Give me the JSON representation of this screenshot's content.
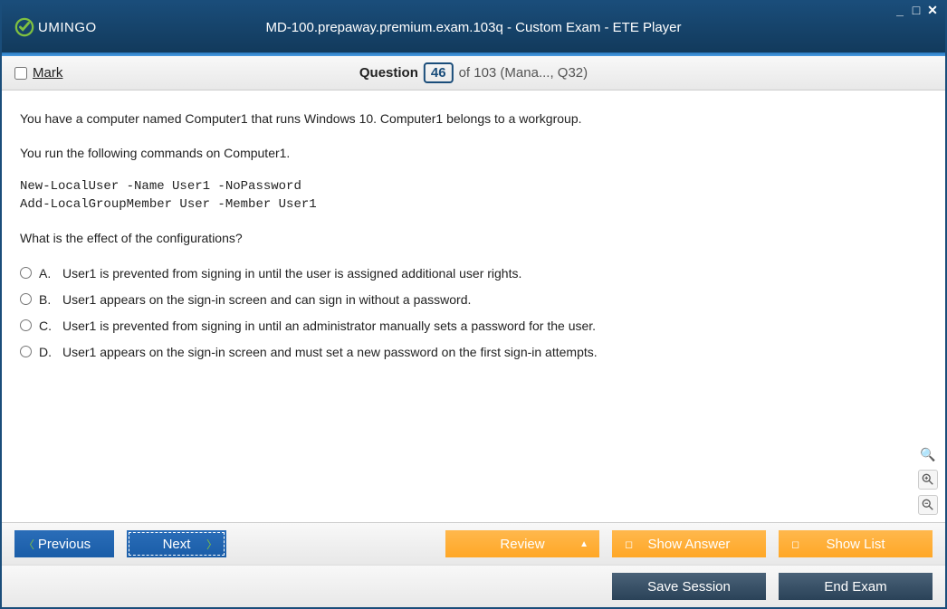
{
  "window": {
    "title": "MD-100.prepaway.premium.exam.103q - Custom Exam - ETE Player",
    "logo_text": "UMINGO"
  },
  "toolbar": {
    "mark_label": "Mark",
    "question_word": "Question",
    "question_number": "46",
    "question_rest": "of 103 (Mana..., Q32)"
  },
  "question": {
    "para1": "You have a computer named Computer1 that runs Windows 10. Computer1 belongs to a workgroup.",
    "para2": "You run the following commands on Computer1.",
    "code": "New-LocalUser -Name User1 -NoPassword\nAdd-LocalGroupMember User -Member User1",
    "para3": "What is the effect of the configurations?",
    "options": [
      {
        "letter": "A.",
        "text": "User1 is prevented from signing in until the user is assigned additional user rights."
      },
      {
        "letter": "B.",
        "text": "User1 appears on the sign-in screen and can sign in without a password."
      },
      {
        "letter": "C.",
        "text": "User1 is prevented from signing in until an administrator manually sets a password for the user."
      },
      {
        "letter": "D.",
        "text": "User1 appears on the sign-in screen and must set a new password on the first sign-in attempts."
      }
    ]
  },
  "buttons": {
    "previous": "Previous",
    "next": "Next",
    "review": "Review",
    "show_answer": "Show Answer",
    "show_list": "Show List",
    "save_session": "Save Session",
    "end_exam": "End Exam"
  }
}
